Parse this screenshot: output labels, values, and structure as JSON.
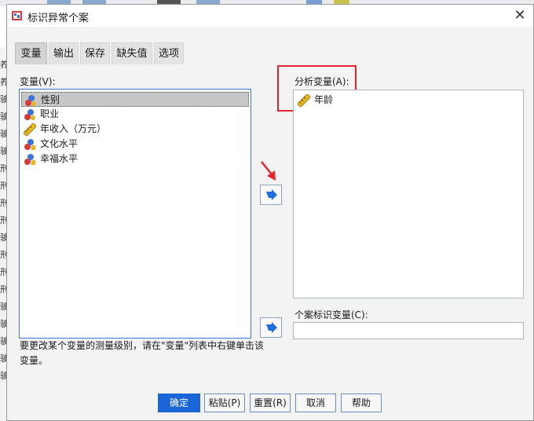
{
  "window": {
    "title": "标识异常个案",
    "close_glyph": "✕"
  },
  "tabs": [
    {
      "label": "变量",
      "active": true
    },
    {
      "label": "输出"
    },
    {
      "label": "保存"
    },
    {
      "label": "缺失值"
    },
    {
      "label": "选项"
    }
  ],
  "variables": {
    "label": "变量(V):",
    "items": [
      {
        "label": "性别",
        "icon": "nominal-icon",
        "selected": true
      },
      {
        "label": "职业",
        "icon": "nominal-icon"
      },
      {
        "label": "年收入（万元）",
        "icon": "scale-ruler-icon"
      },
      {
        "label": "文化水平",
        "icon": "ordinal-icon"
      },
      {
        "label": "幸福水平",
        "icon": "ordinal-icon"
      }
    ]
  },
  "analysis": {
    "label": "分析变量(A):",
    "items": [
      {
        "label": "年龄",
        "icon": "scale-ruler-icon"
      }
    ]
  },
  "case_id": {
    "label": "个案标识变量(C):",
    "value": ""
  },
  "hint": "要更改某个变量的测量级别，请在\"变量\"列表中右键单击该变量。",
  "buttons": {
    "ok": "确定",
    "paste": "粘贴(P)",
    "reset": "重置(R)",
    "cancel": "取消",
    "help": "帮助"
  },
  "colors": {
    "accent": "#1a66d6",
    "highlight": "#e0272e",
    "arrow": "#1f6fdc"
  },
  "background_app": {
    "left_edge_glyphs": [
      "养",
      "养",
      "驶",
      "驶",
      "驶",
      "驶",
      "刑",
      "刑",
      "刑",
      "刑",
      "驶",
      "刑",
      "刑",
      "刑",
      "驶",
      "驶",
      "驶",
      "驶",
      "驶"
    ]
  }
}
